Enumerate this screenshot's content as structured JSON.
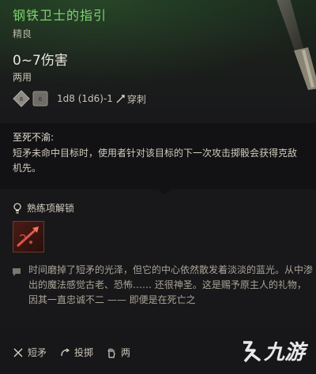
{
  "item": {
    "name": "钢铁卫士的指引",
    "rarity": "精良",
    "damage": "0~7伤害",
    "handedness": "两用",
    "dice": [
      "d8-die-icon",
      "d6-die-icon"
    ],
    "dice_formula": "1d8 (1d6)-1",
    "damage_type": "穿刺",
    "damage_type_icon": "pierce-icon"
  },
  "ability": {
    "name": "至死不渝:",
    "description": "短矛未命中目标时，使用者针对该目标的下一次攻击掷骰会获得克敌机先。"
  },
  "proficiency": {
    "label": "熟练项解锁",
    "icon": "lightbulb-icon",
    "action_icon": "spear-action-icon"
  },
  "lore": "时间磨掉了短矛的光泽，但它的中心依然散发着淡淡的蓝光。从中渗出的魔法感觉古老、恐怖…… 还很神圣。这是赐予原主人的礼物，因其一直忠诚不二 —— 即便是在死亡之",
  "tags": [
    {
      "icon": "spear-icon",
      "label": "短矛"
    },
    {
      "icon": "throw-icon",
      "label": "投掷"
    },
    {
      "icon": "hand-icon",
      "label": "两"
    }
  ],
  "watermark": {
    "text": "九游",
    "icon": "jiuyou-logo"
  },
  "colors": {
    "title": "#7ed36e",
    "action_icon_bg": "#4a1c16",
    "background": "#17171a"
  }
}
